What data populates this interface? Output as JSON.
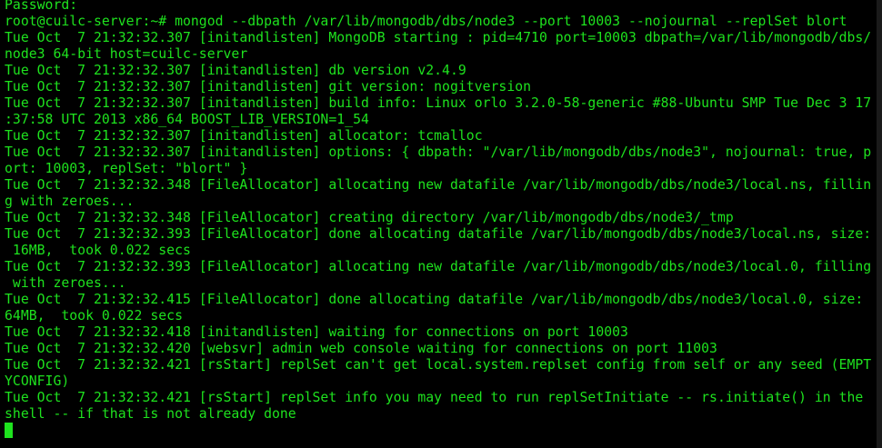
{
  "terminal": {
    "colors": {
      "background": "#000000",
      "foreground": "#1ee21e"
    },
    "lines": [
      "Password:",
      "root@cuilc-server:~# mongod --dbpath /var/lib/mongodb/dbs/node3 --port 10003 --nojournal --replSet blort",
      "Tue Oct  7 21:32:32.307 [initandlisten] MongoDB starting : pid=4710 port=10003 dbpath=/var/lib/mongodb/dbs/",
      "node3 64-bit host=cuilc-server",
      "Tue Oct  7 21:32:32.307 [initandlisten] db version v2.4.9",
      "Tue Oct  7 21:32:32.307 [initandlisten] git version: nogitversion",
      "Tue Oct  7 21:32:32.307 [initandlisten] build info: Linux orlo 3.2.0-58-generic #88-Ubuntu SMP Tue Dec 3 17",
      ":37:58 UTC 2013 x86_64 BOOST_LIB_VERSION=1_54",
      "Tue Oct  7 21:32:32.307 [initandlisten] allocator: tcmalloc",
      "Tue Oct  7 21:32:32.307 [initandlisten] options: { dbpath: \"/var/lib/mongodb/dbs/node3\", nojournal: true, p",
      "ort: 10003, replSet: \"blort\" }",
      "Tue Oct  7 21:32:32.348 [FileAllocator] allocating new datafile /var/lib/mongodb/dbs/node3/local.ns, fillin",
      "g with zeroes...",
      "Tue Oct  7 21:32:32.348 [FileAllocator] creating directory /var/lib/mongodb/dbs/node3/_tmp",
      "Tue Oct  7 21:32:32.393 [FileAllocator] done allocating datafile /var/lib/mongodb/dbs/node3/local.ns, size:",
      " 16MB,  took 0.022 secs",
      "Tue Oct  7 21:32:32.393 [FileAllocator] allocating new datafile /var/lib/mongodb/dbs/node3/local.0, filling",
      " with zeroes...",
      "Tue Oct  7 21:32:32.415 [FileAllocator] done allocating datafile /var/lib/mongodb/dbs/node3/local.0, size:",
      "64MB,  took 0.022 secs",
      "Tue Oct  7 21:32:32.418 [initandlisten] waiting for connections on port 10003",
      "Tue Oct  7 21:32:32.420 [websvr] admin web console waiting for connections on port 11003",
      "Tue Oct  7 21:32:32.421 [rsStart] replSet can't get local.system.replset config from self or any seed (EMPT",
      "YCONFIG)",
      "Tue Oct  7 21:32:32.421 [rsStart] replSet info you may need to run replSetInitiate -- rs.initiate() in the",
      "shell -- if that is not already done"
    ]
  }
}
